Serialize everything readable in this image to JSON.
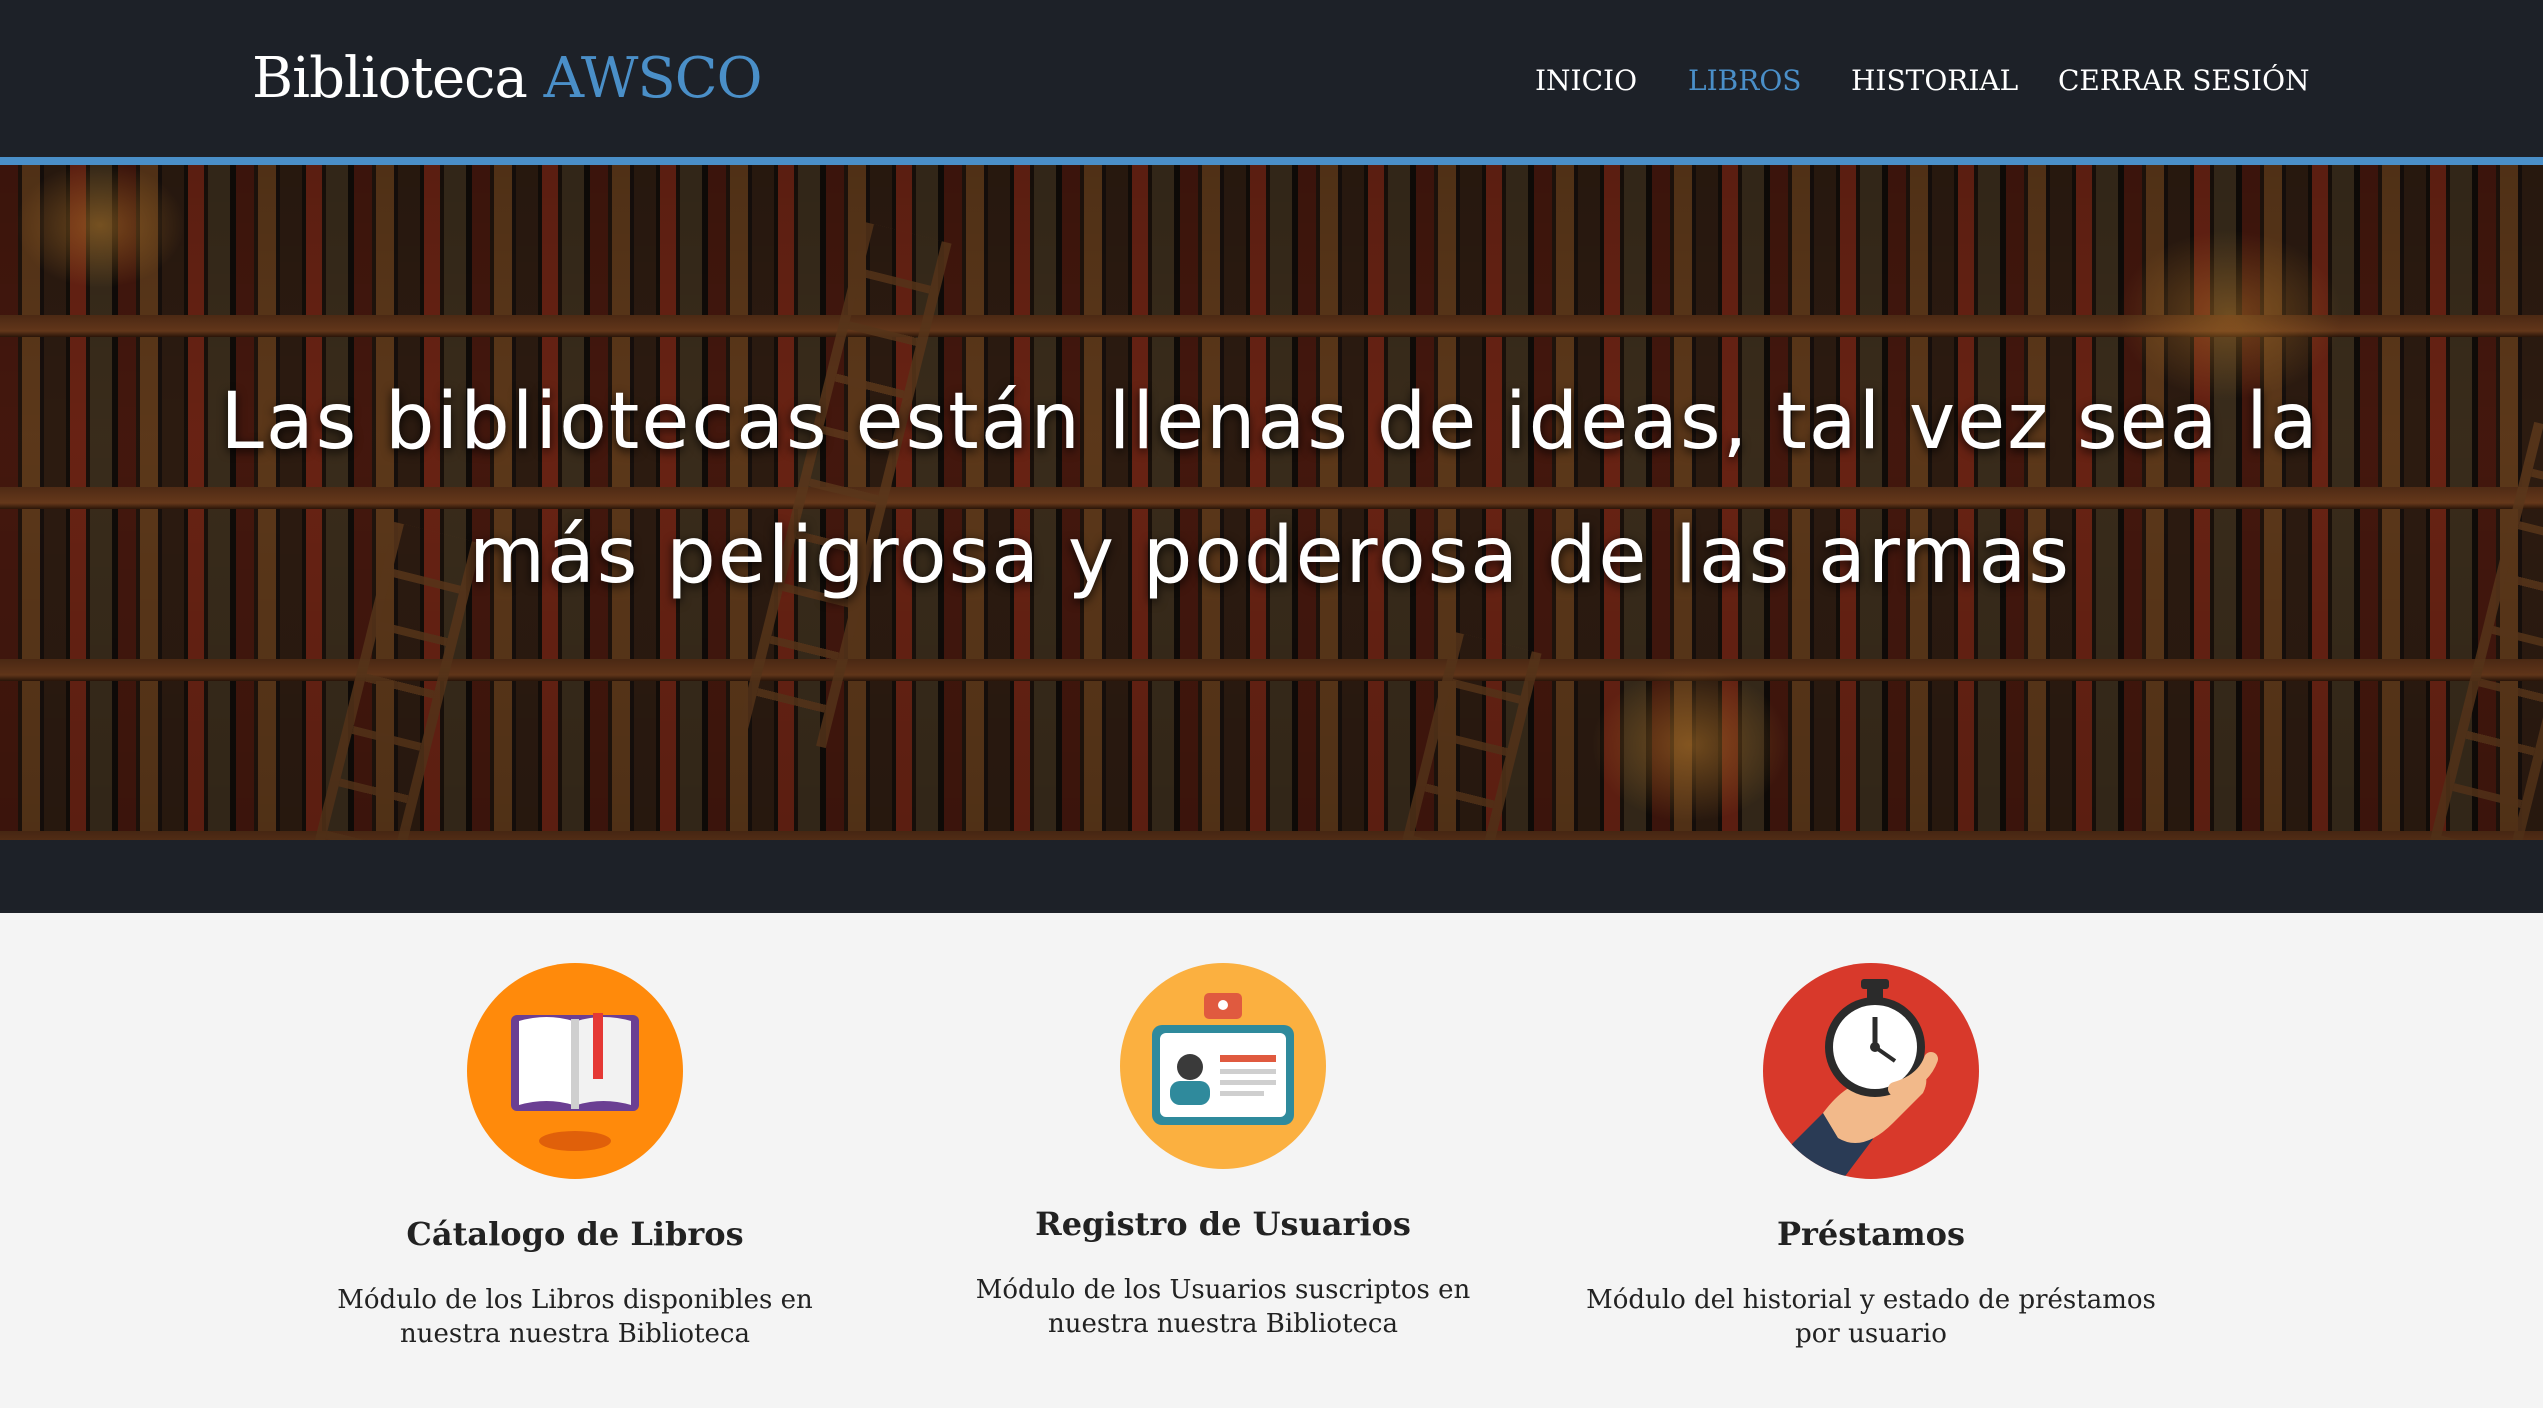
{
  "brand": {
    "name": "Biblioteca",
    "accent": "AWSCO"
  },
  "nav": {
    "items": [
      {
        "label": "INICIO",
        "active": false
      },
      {
        "label": "LIBROS",
        "active": true
      },
      {
        "label": "HISTORIAL",
        "active": false
      },
      {
        "label": "CERRAR SESIÓN",
        "active": false
      }
    ]
  },
  "hero": {
    "quote": "Las bibliotecas están llenas de ideas, tal vez sea la más peligrosa y poderosa de las armas"
  },
  "features": [
    {
      "icon": "open-book-icon",
      "title": "Cátalogo de Libros",
      "description": "Módulo de los Libros disponibles en nuestra nuestra Biblioteca"
    },
    {
      "icon": "id-card-icon",
      "title": "Registro de Usuarios",
      "description": "Módulo de los Usuarios suscriptos en nuestra nuestra Biblioteca"
    },
    {
      "icon": "stopwatch-icon",
      "title": "Préstamos",
      "description": "Módulo del historial y estado de préstamos por usuario"
    }
  ],
  "colors": {
    "navbar_bg": "#1d2128",
    "accent": "#4a8fc8",
    "page_bg": "#f4f4f4",
    "catalog_icon_bg": "#ff8a0b",
    "users_icon_bg": "#fbb040",
    "loans_icon_bg": "#d8392b"
  }
}
